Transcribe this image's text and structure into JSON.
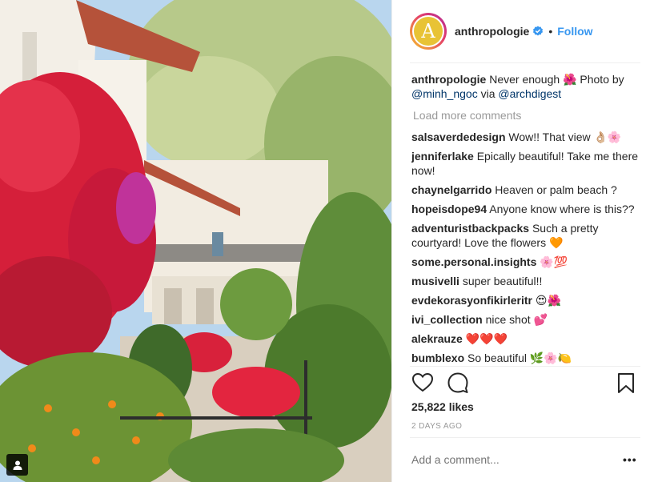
{
  "header": {
    "avatar_letter": "A",
    "username": "anthropologie",
    "separator": "•",
    "follow_label": "Follow"
  },
  "caption": {
    "user": "anthropologie",
    "text_before": "Never enough",
    "emoji": "🌺",
    "text_after": "Photo by",
    "mention1": "@minh_ngoc",
    "via": "via",
    "mention2": "@archdigest"
  },
  "load_more_label": "Load more comments",
  "comments": [
    {
      "user": "salsaverdedesign",
      "text": "Wow!! That view 👌🏼🌸"
    },
    {
      "user": "jenniferlake",
      "text": "Epically beautiful! Take me there now!"
    },
    {
      "user": "chaynelgarrido",
      "text": "Heaven or palm beach ?"
    },
    {
      "user": "hopeisdope94",
      "text": "Anyone know where is this??"
    },
    {
      "user": "adventuristbackpacks",
      "text": "Such a pretty courtyard! Love the flowers 🧡"
    },
    {
      "user": "some.personal.insights",
      "text": "🌸💯"
    },
    {
      "user": "musivelli",
      "text": "super beautiful!!"
    },
    {
      "user": "evdekorasyonfikirleritr",
      "text": "😍🌺"
    },
    {
      "user": "ivi_collection",
      "text": "nice shot 💕"
    },
    {
      "user": "alekrauze",
      "text": "❤️❤️❤️"
    },
    {
      "user": "bumblexo",
      "text": "So beautiful 🌿🌸🍋"
    }
  ],
  "likes": "25,822 likes",
  "timestamp": "2 DAYS AGO",
  "add_comment_placeholder": "Add a comment...",
  "more_options": "•••",
  "icons": {
    "verified": "verified-badge-icon",
    "like": "heart-icon",
    "comment": "comment-icon",
    "save": "bookmark-icon",
    "tag": "user-tag-icon"
  },
  "colors": {
    "accent": "#3897f0",
    "mention": "#003569",
    "muted": "#999999",
    "avatar_bg": "#e8c335"
  }
}
